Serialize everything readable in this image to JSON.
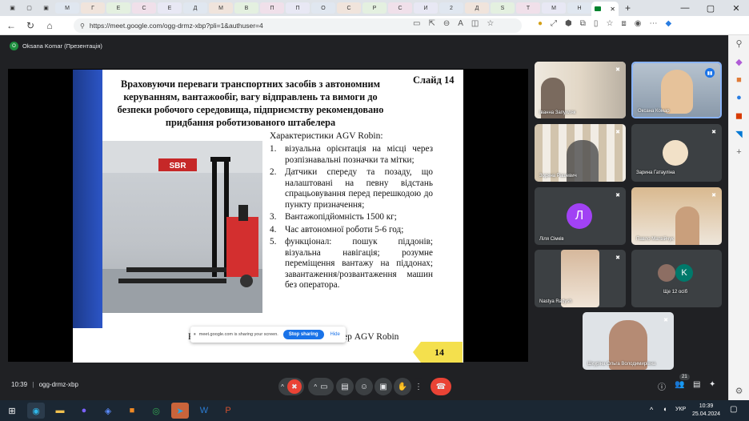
{
  "browser": {
    "active_tab_icon": "meet-icon",
    "new_tab": "+",
    "url": "https://meet.google.com/ogg-drmz-xbp?pli=1&authuser=4",
    "tab_labels": [
      "М",
      "Г",
      "Е",
      "С",
      "Е",
      "Д",
      "М",
      "В",
      "П",
      "П",
      "О",
      "С",
      "Р",
      "С",
      "И",
      "2",
      "Д",
      "S",
      "Т",
      "М",
      "Н"
    ]
  },
  "meet": {
    "presenter_label": "Oksana Komar (Презентація)",
    "meeting_time": "10:39",
    "meeting_code": "ogg-drmz-xbp",
    "participants_count": "21"
  },
  "slide": {
    "heading": "Враховуючи переваги транспортних засобів з автономним керуванням, вантажообіг, вагу відправлень та вимоги до безпеки робочого середовища, підприємству рекомендовано придбання роботизованого штабелера",
    "slide_label": "Слайд  14",
    "photo_brand": "SBR",
    "chars_title": "Характеристики AGV Robin:",
    "items": [
      {
        "n": "1.",
        "text": "візуальна орієнтація на місці через розпізнавальні позначки та мітки;"
      },
      {
        "n": "2.",
        "text": "Датчики спереду та позаду, що налаштовані на певну відстань спрацьовування перед перешкодою до пункту призначення;"
      },
      {
        "n": "3.",
        "text": "Вантажопідйомність 1500 кг;"
      },
      {
        "n": "4.",
        "text": "Час автономної роботи 5-6 год;"
      },
      {
        "n": "5.",
        "text": "функціонал: пошук піддонів; візуальна навігація; розумне переміщення вантажу на піддонах; завантаження/розвантаження машин без оператора."
      }
    ],
    "caption_left": "Р",
    "caption_right": "ер AGV Robin",
    "page_number": "14"
  },
  "sharebar": {
    "message": "meet.google.com is sharing your screen.",
    "stop_label": "Stop sharing",
    "hide_label": "Hide"
  },
  "participants": [
    {
      "name": "Іванна Запухляк"
    },
    {
      "name": "Оксана Комар"
    },
    {
      "name": "Зоряна Рашевич"
    },
    {
      "name": "Зарина Гатауліна"
    },
    {
      "name": "Ліля Сімків",
      "initial": "Л"
    },
    {
      "name": "Павло Матвійчук"
    },
    {
      "name": "Nastya Radysh"
    },
    {
      "name": "Ще 12 осіб",
      "initial": "K"
    },
    {
      "name": "Шкуріна Ольга Володимирівна"
    }
  ],
  "taskbar": {
    "lang": "УКР",
    "time": "10:39",
    "date": "25.04.2024"
  },
  "colors": {
    "meet_bg": "#202124",
    "slide_blue": "#2c55c6",
    "badge_yellow": "#f4e04d",
    "hangup_red": "#ea4335",
    "share_blue": "#1a73e8"
  }
}
